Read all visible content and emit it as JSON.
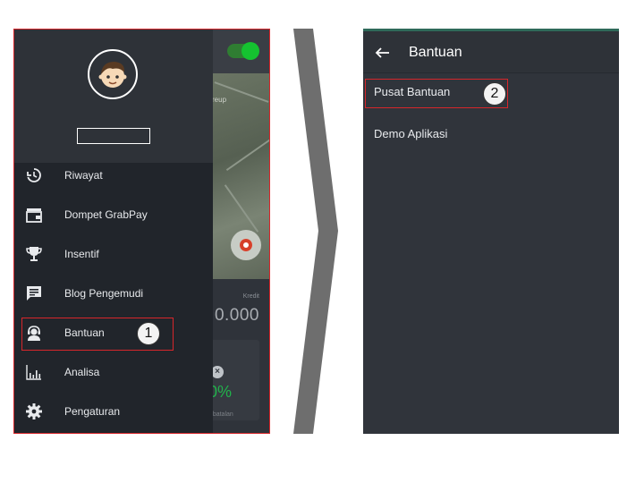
{
  "left_screen": {
    "background_app": {
      "map_place_label": "reup",
      "kredit_label": "Kredit",
      "kredit_amount": "0.000",
      "percent_value": "0%",
      "percent_caption": "mbatalan"
    },
    "drawer": {
      "driver_name": "",
      "menu": [
        {
          "label": "Riwayat",
          "icon": "history-icon"
        },
        {
          "label": "Dompet GrabPay",
          "icon": "wallet-icon"
        },
        {
          "label": "Insentif",
          "icon": "trophy-icon"
        },
        {
          "label": "Blog Pengemudi",
          "icon": "blog-icon"
        },
        {
          "label": "Bantuan",
          "icon": "support-agent-icon"
        },
        {
          "label": "Analisa",
          "icon": "bar-chart-icon"
        },
        {
          "label": "Pengaturan",
          "icon": "gear-icon"
        }
      ]
    },
    "step_badge": "1"
  },
  "right_screen": {
    "title": "Bantuan",
    "items": [
      "Pusat Bantuan",
      "Demo Aplikasi"
    ],
    "step_badge": "2"
  },
  "colors": {
    "highlight": "#d7262b",
    "drawer_bg": "#21252b",
    "screen_bg": "#30343b",
    "toggle_on": "#15c230",
    "chevron": "#6e6e6e"
  }
}
